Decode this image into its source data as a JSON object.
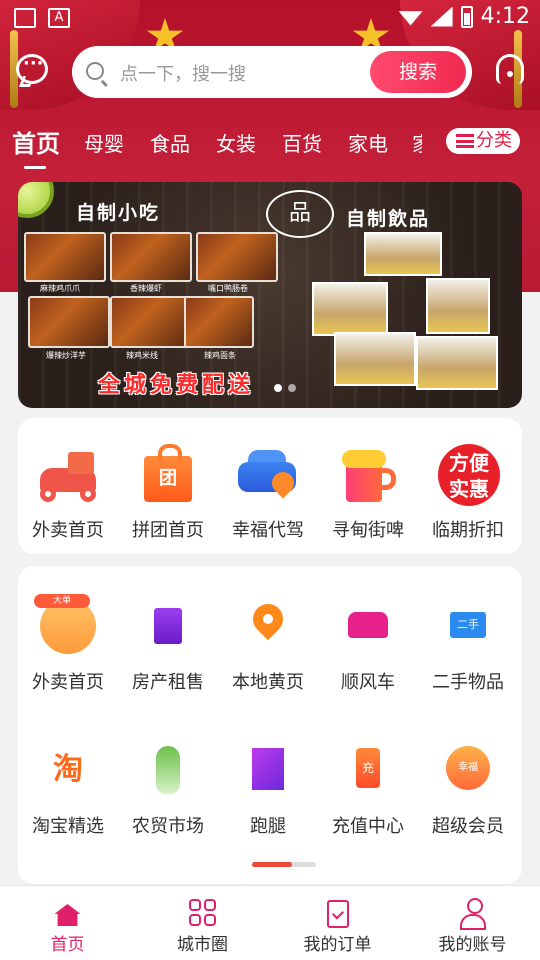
{
  "status_bar": {
    "time": "4:12"
  },
  "search": {
    "placeholder": "点一下，搜一搜",
    "button_label": "搜索"
  },
  "tabs": [
    {
      "label": "首页",
      "active": true
    },
    {
      "label": "母婴"
    },
    {
      "label": "食品"
    },
    {
      "label": "女装"
    },
    {
      "label": "百货"
    },
    {
      "label": "家电"
    },
    {
      "label": "家"
    }
  ],
  "category_button": {
    "label": "分类"
  },
  "banner": {
    "title_left": "自制小吃",
    "title_right": "自制飲品",
    "logo_text": "品",
    "slogan": "全城免费配送",
    "food_captions": [
      "麻辣鸡爪爪",
      "香辣爆虾",
      "嘴口鸭肠卷",
      "爆辣炒洋芋",
      "辣鸡米线",
      "辣鸡面条"
    ],
    "slide_count": 2,
    "active_slide": 0
  },
  "quick_entries": [
    {
      "label": "外卖首页",
      "icon": "scooter-icon"
    },
    {
      "label": "拼团首页",
      "icon": "group-bag-icon",
      "icon_text": "团"
    },
    {
      "label": "幸福代驾",
      "icon": "car-location-icon"
    },
    {
      "label": "寻甸街啤",
      "icon": "beer-icon"
    },
    {
      "label": "临期折扣",
      "icon": "deal-badge-icon",
      "icon_text_line1": "方便",
      "icon_text_line2": "实惠"
    }
  ],
  "services_row1": [
    {
      "label": "外卖首页",
      "icon": "delivery-round-icon",
      "icon_tag": "大单"
    },
    {
      "label": "房产租售",
      "icon": "building-icon"
    },
    {
      "label": "本地黄页",
      "icon": "location-pin-icon"
    },
    {
      "label": "顺风车",
      "icon": "ride-share-car-icon"
    },
    {
      "label": "二手物品",
      "icon": "second-hand-sign-icon",
      "icon_text": "二手"
    }
  ],
  "services_row2": [
    {
      "label": "淘宝精选",
      "icon": "taobao-icon",
      "icon_text": "淘"
    },
    {
      "label": "农贸市场",
      "icon": "vegetable-icon"
    },
    {
      "label": "跑腿",
      "icon": "runner-icon"
    },
    {
      "label": "充值中心",
      "icon": "phone-charge-icon",
      "icon_text": "充"
    },
    {
      "label": "超级会员",
      "icon": "vip-badge-icon",
      "icon_text": "幸福"
    }
  ],
  "services_pager": {
    "pages": 2,
    "active": 0
  },
  "bottom_nav": [
    {
      "label": "首页",
      "active": true
    },
    {
      "label": "城市圈"
    },
    {
      "label": "我的订单"
    },
    {
      "label": "我的账号"
    }
  ],
  "colors": {
    "header_red": "#b4102a",
    "accent_pink": "#f02a50",
    "nav_active": "#e0206a"
  }
}
